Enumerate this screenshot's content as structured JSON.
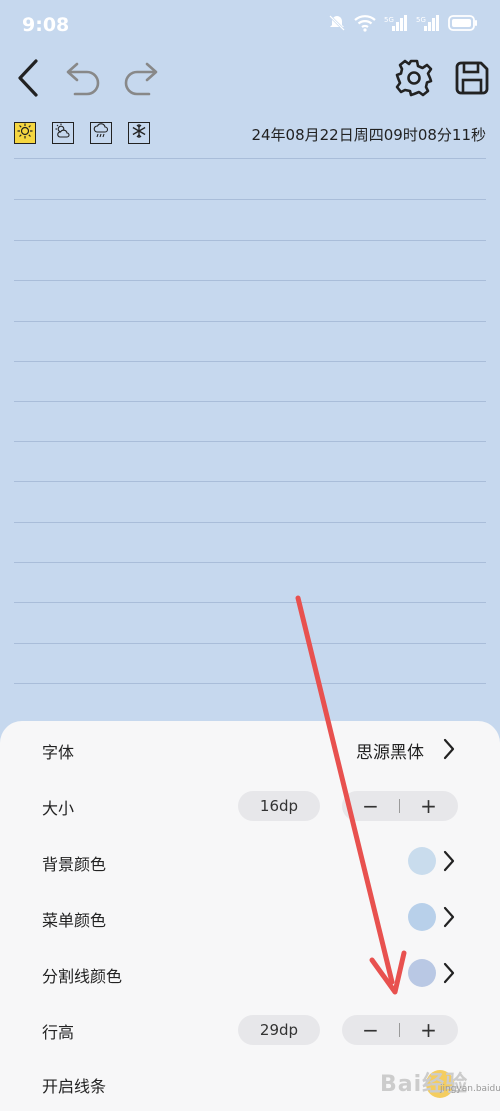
{
  "status_bar": {
    "time": "9:08",
    "icons": [
      "mute-icon",
      "wifi-icon",
      "signal-icon",
      "signal-icon",
      "battery-icon"
    ]
  },
  "toolbar": {
    "icons": [
      "back-icon",
      "undo-icon",
      "redo-icon",
      "settings-icon",
      "save-icon"
    ]
  },
  "weather": {
    "options": [
      "sunny-icon",
      "partly-cloudy-icon",
      "rain-icon",
      "snow-icon"
    ],
    "selected": "sunny-icon"
  },
  "date_text": "24年08月22日周四09时08分11秒",
  "settings": {
    "font": {
      "label": "字体",
      "value": "思源黑体"
    },
    "size": {
      "label": "大小",
      "value": "16dp",
      "minus": "−",
      "plus": "+"
    },
    "background_color": {
      "label": "背景颜色",
      "color": "#c9dced"
    },
    "menu_color": {
      "label": "菜单颜色",
      "color": "#b8d0ea"
    },
    "divider_color": {
      "label": "分割线颜色",
      "color": "#b9c8e4"
    },
    "line_height": {
      "label": "行高",
      "value": "29dp",
      "minus": "−",
      "plus": "+"
    },
    "enable_lines": {
      "label": "开启线条"
    }
  },
  "colors": {
    "page_bg": "#c6d8ee",
    "annotation_arrow": "#e8514f",
    "weather_selected": "#f5d640"
  },
  "watermark": {
    "text": "Bai经验",
    "sub": "jingyan.baidu.com"
  }
}
